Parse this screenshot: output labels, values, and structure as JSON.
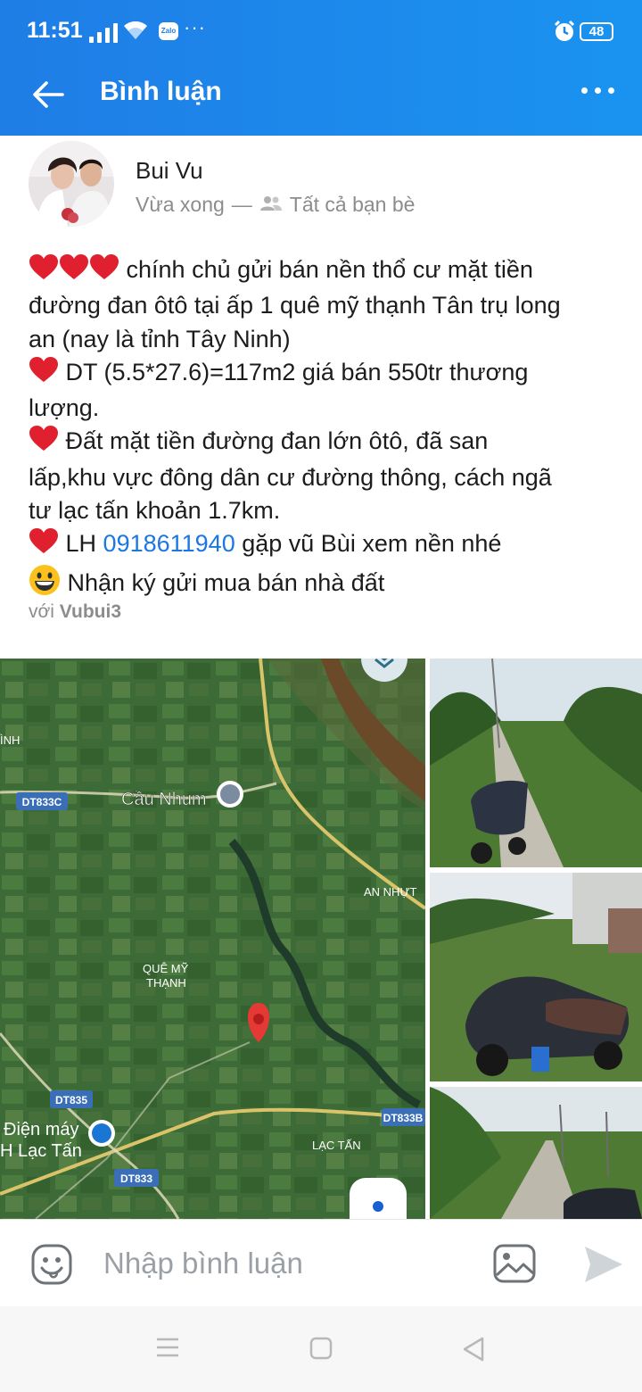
{
  "status_bar": {
    "time": "11:51",
    "notification_app": "Zalo",
    "battery": "48"
  },
  "header": {
    "title": "Bình luận"
  },
  "post": {
    "author": "Bui Vu",
    "time": "Vừa xong",
    "separator": "—",
    "privacy": "Tất cả bạn bè",
    "lines": [
      "chính chủ gửi bán nền thổ cư mặt tiền",
      "đường đan ôtô tại ấp 1 quê mỹ thạnh Tân trụ long",
      "an (nay là tỉnh Tây Ninh)",
      "DT (5.5*27.6)=117m2 giá bán 550tr thương",
      "lượng.",
      "Đất mặt tiền đường đan lớn ôtô, đã san",
      "lấp,khu vực đông dân cư đường thông, cách ngã",
      "tư lạc tấn khoản 1.7km.",
      "LH",
      "0918611940",
      "gặp vũ Bùi xem nền nhé",
      "Nhận ký gửi mua bán nhà đất"
    ],
    "with_prefix": "với",
    "tagged": "Vubui3"
  },
  "map": {
    "labels": [
      "ÌNH",
      "DT833C",
      "Cầu Nhum",
      "AN NHỰT",
      "QUÊ MỸ",
      "THẠNH",
      "DT835",
      "Điện máy",
      "H Lạc Tấn",
      "DT833",
      "DT833B",
      "LẠC TẤN"
    ]
  },
  "composer": {
    "placeholder": "Nhập bình luận"
  },
  "icons": {
    "back": "arrow-left-icon",
    "menu": "more-vertical-dots-icon",
    "emoji": "sticker-icon",
    "image": "image-icon",
    "send": "send-icon",
    "privacy": "friends-icon",
    "nav": [
      "menu-icon",
      "home-icon",
      "back-icon"
    ]
  },
  "colors": {
    "primary": "#1a88ea",
    "link": "#1a78e0",
    "heart": "#e0202e",
    "pin": "#e53935"
  }
}
